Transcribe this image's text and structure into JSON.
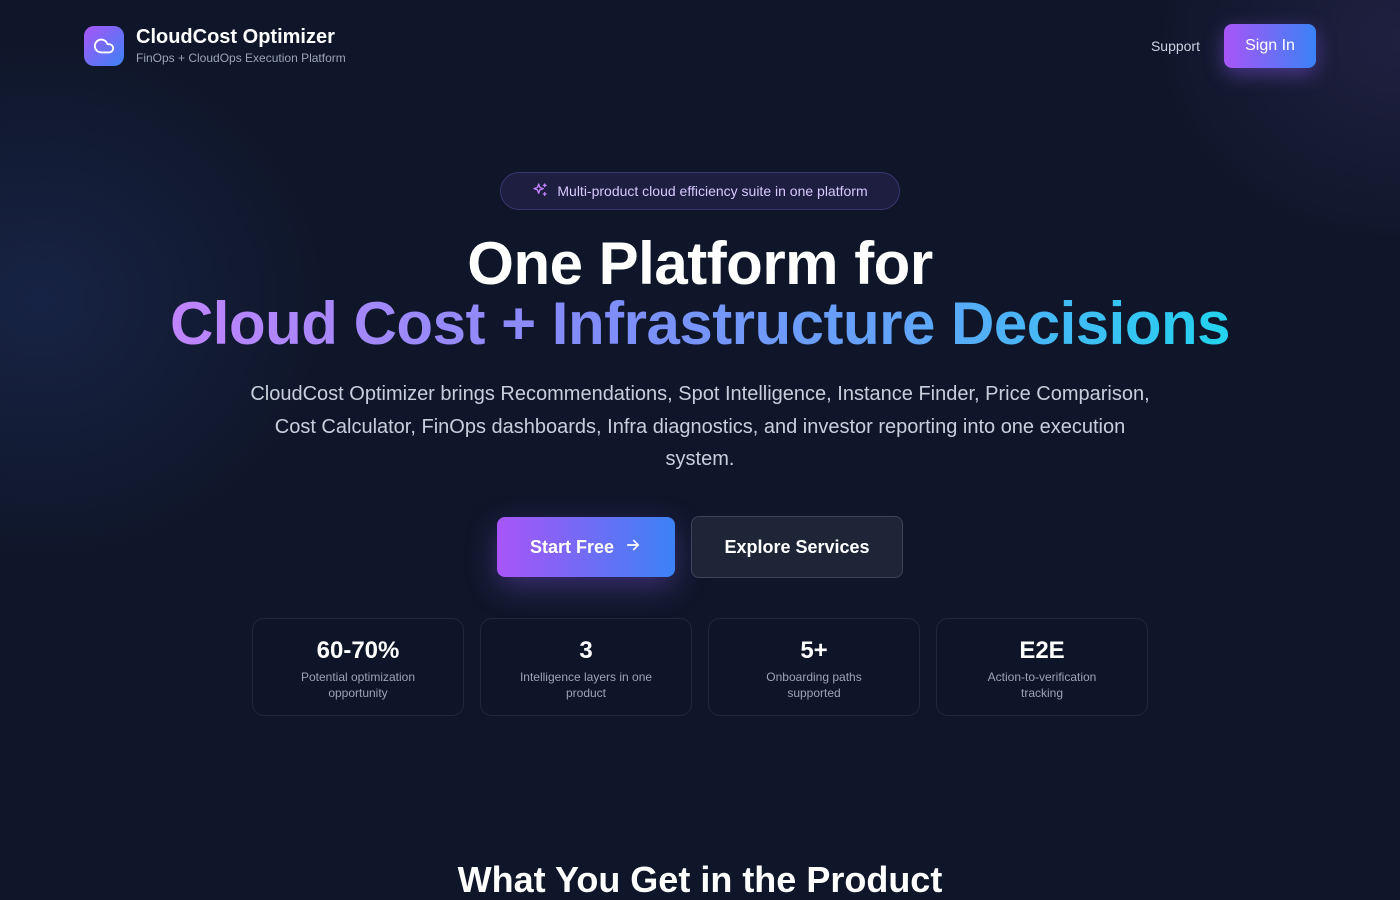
{
  "header": {
    "brand_title": "CloudCost Optimizer",
    "brand_subtitle": "FinOps + CloudOps Execution Platform",
    "logo_icon": "cloud-icon",
    "support_label": "Support",
    "signin_label": "Sign In"
  },
  "hero": {
    "badge_icon": "sparkles-icon",
    "badge_text": "Multi-product cloud efficiency suite in one platform",
    "title_line1": "One Platform for",
    "title_line2": "Cloud Cost + Infrastructure Decisions",
    "description": "CloudCost Optimizer brings Recommendations, Spot Intelligence, Instance Finder, Price Comparison, Cost Calculator, FinOps dashboards, Infra diagnostics, and investor reporting into one execution system.",
    "start_label": "Start Free",
    "start_icon": "arrow-right-icon",
    "explore_label": "Explore Services"
  },
  "stats": [
    {
      "value": "60-70%",
      "label": "Potential optimization opportunity"
    },
    {
      "value": "3",
      "label": "Intelligence layers in one product"
    },
    {
      "value": "5+",
      "label": "Onboarding paths supported"
    },
    {
      "value": "E2E",
      "label": "Action-to-verification tracking"
    }
  ],
  "section": {
    "title": "What You Get in the Product"
  },
  "colors": {
    "background": "#0f1629",
    "accent_start": "#a855f7",
    "accent_end": "#3b82f6",
    "gradient_cyan": "#22d3ee"
  }
}
